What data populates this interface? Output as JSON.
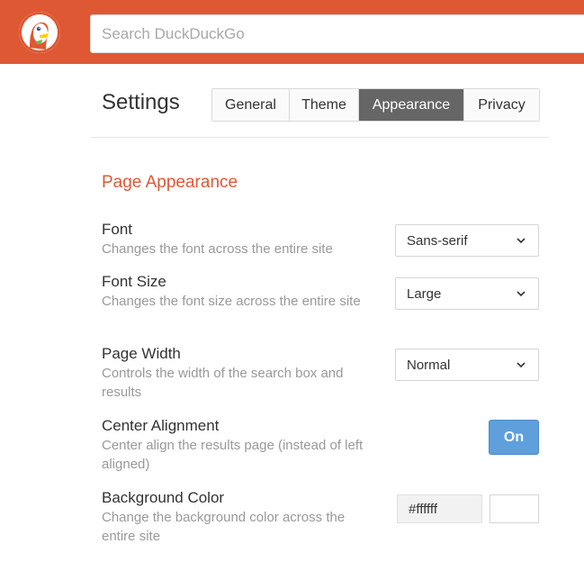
{
  "colors": {
    "brand": "#de5833",
    "active_tab": "#666666",
    "toggle_on": "#5e9fdc"
  },
  "header": {
    "logo_icon": "duckduckgo-logo",
    "search_placeholder": "Search DuckDuckGo"
  },
  "settings": {
    "title": "Settings",
    "tabs": [
      {
        "label": "General",
        "active": false
      },
      {
        "label": "Theme",
        "active": false
      },
      {
        "label": "Appearance",
        "active": true
      },
      {
        "label": "Privacy",
        "active": false
      }
    ]
  },
  "page_appearance": {
    "section_title": "Page Appearance",
    "font": {
      "label": "Font",
      "description": "Changes the font across the entire site",
      "value": "Sans-serif",
      "icon": "chevron-down-icon"
    },
    "font_size": {
      "label": "Font Size",
      "description": "Changes the font size across the entire site",
      "value": "Large",
      "icon": "chevron-down-icon"
    },
    "page_width": {
      "label": "Page Width",
      "description": "Controls the width of the search box and results",
      "value": "Normal",
      "icon": "chevron-down-icon"
    },
    "center_alignment": {
      "label": "Center Alignment",
      "description": "Center align the results page (instead of left aligned)",
      "toggle_label": "On"
    },
    "background_color": {
      "label": "Background Color",
      "description": "Change the background color across the entire site",
      "value": "#ffffff",
      "swatch_color": "#ffffff"
    }
  }
}
